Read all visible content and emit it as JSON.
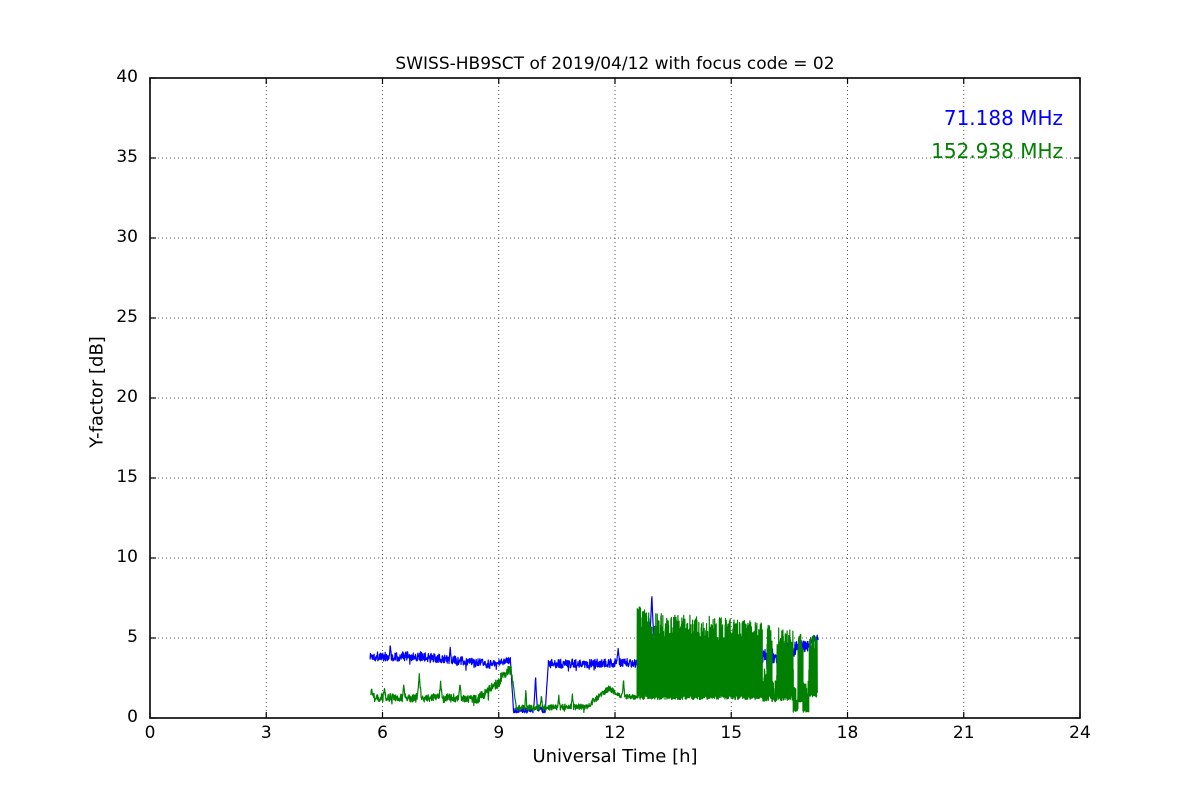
{
  "chart_data": {
    "type": "line",
    "title": "SWISS-HB9SCT of 2019/04/12 with focus code = 02",
    "xlabel": "Universal Time [h]",
    "ylabel": "Y-factor [dB]",
    "xlim": [
      0,
      24
    ],
    "ylim": [
      0,
      40
    ],
    "xticks": [
      0,
      3,
      6,
      9,
      12,
      15,
      18,
      21,
      24
    ],
    "yticks": [
      0,
      5,
      10,
      15,
      20,
      25,
      30,
      35,
      40
    ],
    "grid": true,
    "grid_style": "dotted",
    "background": "#ffffff",
    "legend": {
      "position": "upper-right-inside",
      "entries": [
        {
          "label": "71.188 MHz",
          "color": "#0000ff"
        },
        {
          "label": "152.938 MHz",
          "color": "#008000"
        }
      ]
    },
    "series": [
      {
        "name": "71.188 MHz",
        "color": "#0000ff",
        "time_range_h": [
          5.68,
          17.25
        ],
        "segments": [
          {
            "t0": 5.68,
            "t1": 7.0,
            "v0": 3.85,
            "v1": 3.85,
            "noise": 0.3
          },
          {
            "t0": 7.0,
            "t1": 8.8,
            "v0": 3.85,
            "v1": 3.35,
            "noise": 0.28
          },
          {
            "t0": 8.8,
            "t1": 9.3,
            "v0": 3.35,
            "v1": 3.6,
            "noise": 0.22
          },
          {
            "t0": 9.3,
            "t1": 9.38,
            "v0": 3.6,
            "v1": 0.55,
            "noise": 0.1
          },
          {
            "t0": 9.38,
            "t1": 10.2,
            "v0": 0.5,
            "v1": 0.5,
            "noise": 0.18
          },
          {
            "t0": 10.2,
            "t1": 10.28,
            "v0": 0.5,
            "v1": 3.4,
            "noise": 0.1
          },
          {
            "t0": 10.28,
            "t1": 12.6,
            "v0": 3.4,
            "v1": 3.45,
            "noise": 0.28
          },
          {
            "t0": 12.6,
            "t1": 13.0,
            "v0": 3.3,
            "v1": 3.4,
            "noise": 0.22
          },
          {
            "t0": 13.0,
            "t1": 16.4,
            "v0": 3.8,
            "v1": 3.9,
            "noise": 0.45
          },
          {
            "t0": 16.4,
            "t1": 17.05,
            "v0": 4.3,
            "v1": 4.5,
            "noise": 0.4
          },
          {
            "t0": 17.05,
            "t1": 17.25,
            "v0": 4.9,
            "v1": 5.1,
            "noise": 0.25
          }
        ],
        "spikes": [
          {
            "t": 6.2,
            "v": 4.6,
            "w": 0.03
          },
          {
            "t": 7.75,
            "v": 4.5,
            "w": 0.03
          },
          {
            "t": 9.95,
            "v": 2.8,
            "w": 0.05
          },
          {
            "t": 12.08,
            "v": 4.45,
            "w": 0.04
          },
          {
            "t": 12.95,
            "v": 7.9,
            "w": 0.1
          }
        ]
      },
      {
        "name": "152.938 MHz",
        "color": "#008000",
        "time_range_h": [
          5.7,
          17.22
        ],
        "segments": [
          {
            "t0": 5.7,
            "t1": 8.5,
            "v0": 1.3,
            "v1": 1.2,
            "noise": 0.28
          },
          {
            "t0": 8.5,
            "t1": 9.05,
            "v0": 1.3,
            "v1": 2.3,
            "noise": 0.3
          },
          {
            "t0": 9.05,
            "t1": 9.32,
            "v0": 2.5,
            "v1": 3.1,
            "noise": 0.3
          },
          {
            "t0": 9.32,
            "t1": 9.45,
            "v0": 3.0,
            "v1": 0.7,
            "noise": 0.12
          },
          {
            "t0": 9.45,
            "t1": 11.3,
            "v0": 0.62,
            "v1": 0.72,
            "noise": 0.18
          },
          {
            "t0": 11.3,
            "t1": 11.85,
            "v0": 0.8,
            "v1": 1.85,
            "noise": 0.2
          },
          {
            "t0": 11.85,
            "t1": 12.2,
            "v0": 1.85,
            "v1": 1.35,
            "noise": 0.18
          },
          {
            "t0": 12.2,
            "t1": 12.57,
            "v0": 1.35,
            "v1": 1.3,
            "noise": 0.15
          }
        ],
        "bands": [
          {
            "t0": 12.57,
            "t1": 12.9,
            "lo": 1.15,
            "hi0": 7.0,
            "hi1": 6.8
          },
          {
            "t0": 12.9,
            "t1": 13.02,
            "lo": 1.15,
            "hi0": 5.8,
            "hi1": 5.8
          },
          {
            "t0": 13.02,
            "t1": 13.1,
            "lo": 1.15,
            "hi0": 6.6,
            "hi1": 6.6
          },
          {
            "t0": 13.1,
            "t1": 15.8,
            "lo": 1.15,
            "hi0": 6.6,
            "hi1": 6.1
          },
          {
            "t0": 15.8,
            "t1": 15.92,
            "lo": 1.05,
            "hi0": 3.2,
            "hi1": 3.2
          },
          {
            "t0": 15.92,
            "t1": 16.05,
            "lo": 1.1,
            "hi0": 5.8,
            "hi1": 5.8
          },
          {
            "t0": 16.05,
            "t1": 16.18,
            "lo": 1.0,
            "hi0": 2.8,
            "hi1": 2.8
          },
          {
            "t0": 16.18,
            "t1": 16.6,
            "lo": 1.1,
            "hi0": 5.7,
            "hi1": 5.5
          },
          {
            "t0": 16.6,
            "t1": 16.72,
            "lo": 0.35,
            "hi0": 2.0,
            "hi1": 2.0
          },
          {
            "t0": 16.72,
            "t1": 16.85,
            "lo": 1.0,
            "hi0": 5.5,
            "hi1": 5.4
          },
          {
            "t0": 16.85,
            "t1": 17.0,
            "lo": 0.35,
            "hi0": 2.3,
            "hi1": 2.3
          },
          {
            "t0": 17.0,
            "t1": 17.22,
            "lo": 1.3,
            "hi0": 5.2,
            "hi1": 5.3
          }
        ],
        "spikes": [
          {
            "t": 5.72,
            "v": 1.9,
            "w": 0.04
          },
          {
            "t": 6.05,
            "v": 1.9,
            "w": 0.04
          },
          {
            "t": 6.55,
            "v": 2.15,
            "w": 0.04
          },
          {
            "t": 6.95,
            "v": 2.9,
            "w": 0.05
          },
          {
            "t": 7.5,
            "v": 2.3,
            "w": 0.04
          },
          {
            "t": 8.0,
            "v": 2.2,
            "w": 0.04
          },
          {
            "t": 9.7,
            "v": 1.9,
            "w": 0.03
          },
          {
            "t": 10.1,
            "v": 1.5,
            "w": 0.03
          },
          {
            "t": 10.55,
            "v": 1.45,
            "w": 0.03
          },
          {
            "t": 10.9,
            "v": 1.6,
            "w": 0.03
          },
          {
            "t": 12.22,
            "v": 2.6,
            "w": 0.03
          }
        ]
      }
    ]
  }
}
